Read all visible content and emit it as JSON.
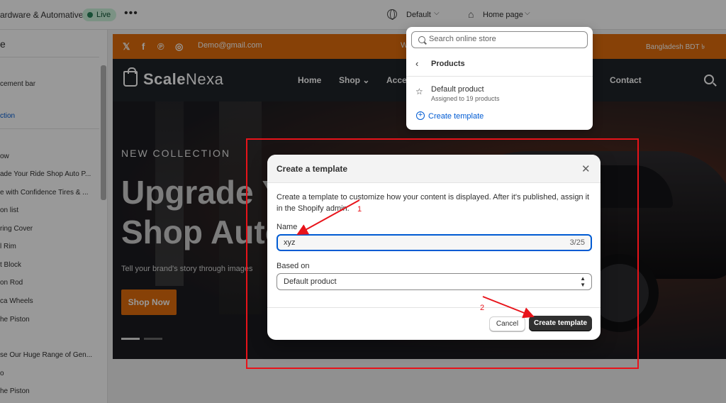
{
  "topbar": {
    "store_name": "ardware & Automative",
    "status": "Live",
    "more": "•••",
    "theme_selector": "Default",
    "page_selector": "Home page"
  },
  "sidebar": {
    "title": "e",
    "items": [
      {
        "label": "cement bar"
      },
      {
        "label": "ction"
      },
      {
        "label": "ow"
      },
      {
        "label": "ade Your Ride Shop Auto P..."
      },
      {
        "label": "e with Confidence Tires & ..."
      },
      {
        "label": "on list"
      },
      {
        "label": "ring Cover"
      },
      {
        "label": "l Rim"
      },
      {
        "label": "t Block"
      },
      {
        "label": "on Rod"
      },
      {
        "label": "ca Wheels"
      },
      {
        "label": "he Piston"
      },
      {
        "label": "se Our Huge Range of Gen..."
      },
      {
        "label": "o"
      },
      {
        "label": "he Piston"
      }
    ]
  },
  "preview": {
    "announcement": {
      "email": "Demo@gmail.com",
      "middle_text": "W",
      "currency": "Bangladesh BDT ৳",
      "social_icons": [
        "x-icon",
        "facebook-icon",
        "pinterest-icon",
        "instagram-icon"
      ]
    },
    "nav": {
      "logo_part1": "Scale",
      "logo_part2": "Nexa",
      "links": [
        "Home",
        "Shop",
        "Access",
        "Contact"
      ],
      "shop_chevron": "⌄"
    },
    "hero": {
      "eyebrow": "NEW COLLECTION",
      "title": "Upgrade Y\nShop Auto",
      "subtitle": "Tell your brand's story through images",
      "button": "Shop Now"
    },
    "colors": {
      "accent": "#e26d0c",
      "nav_bg": "#1e2329"
    }
  },
  "dropdown": {
    "search_placeholder": "Search online store",
    "back_label": "Products",
    "template_name": "Default product",
    "template_assigned": "Assigned to 19 products",
    "create_label": "Create template"
  },
  "modal": {
    "title": "Create a template",
    "description": "Create a template to customize how your content is displayed. After it's published, assign it in the Shopify admin.",
    "name_label": "Name",
    "name_value": "xyz",
    "name_count": "3/25",
    "based_on_label": "Based on",
    "based_on_value": "Default product",
    "cancel_label": "Cancel",
    "create_label": "Create template"
  },
  "annotations": {
    "step1": "1",
    "step2": "2",
    "color": "#e8131a"
  }
}
